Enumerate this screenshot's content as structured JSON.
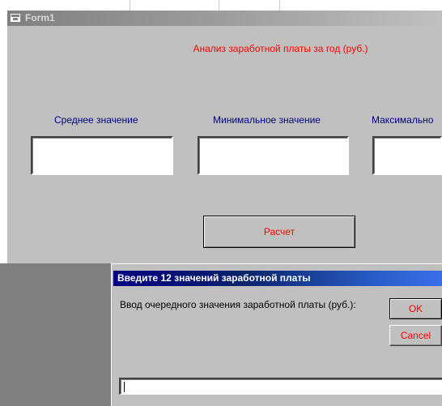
{
  "form": {
    "title": "Form1",
    "heading": "Анализ заработной платы за год (руб.)",
    "labels": {
      "average": "Среднее значение",
      "minimum": "Минимальное значение",
      "maximum": "Максимально"
    },
    "fields": {
      "average": "",
      "minimum": "",
      "maximum": ""
    },
    "calculate_label": "Расчет"
  },
  "dialog": {
    "title": "Введите 12 значений заработной платы",
    "prompt": "Ввод очередного значения заработной платы (руб.):",
    "ok_label": "OK",
    "cancel_label": "Cancel",
    "input_value": ""
  },
  "colors": {
    "window_bg": "#c0c0c0",
    "accent_red": "#ff0000",
    "label_blue": "#000080",
    "dialog_title_bg": "#000080"
  }
}
